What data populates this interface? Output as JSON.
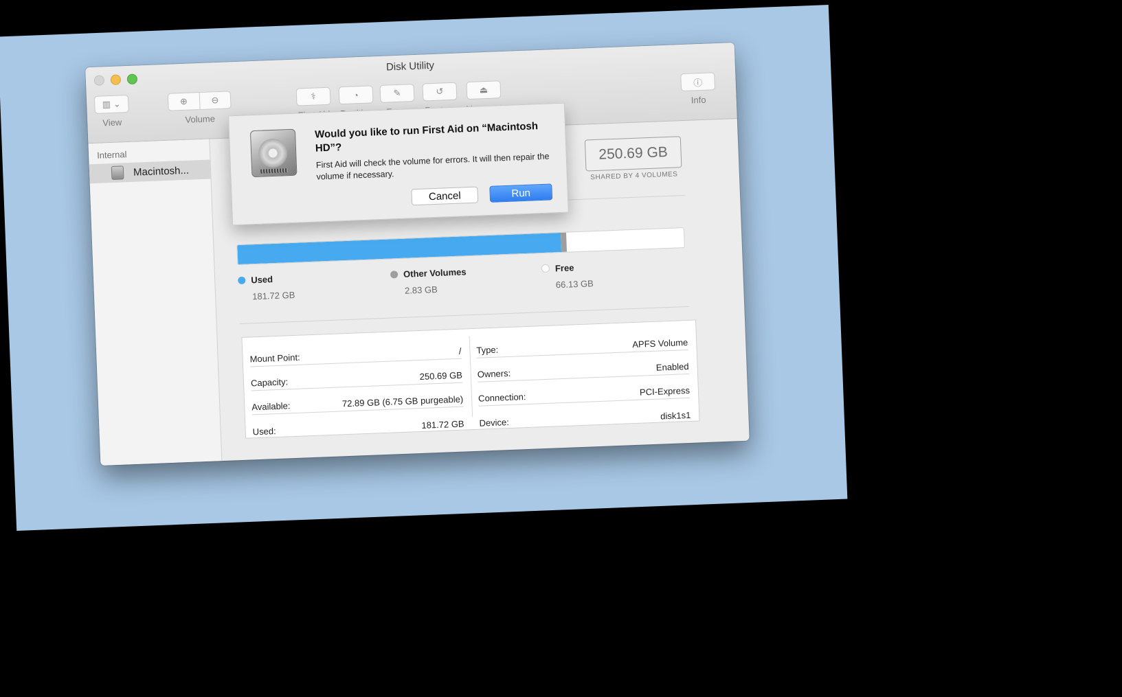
{
  "window": {
    "title": "Disk Utility"
  },
  "toolbar": {
    "view_label": "View",
    "volume_label": "Volume",
    "first_aid_label": "First Aid",
    "partition_label": "Partition",
    "erase_label": "Erase",
    "restore_label": "Restore",
    "unmount_label": "Unmount",
    "info_label": "Info"
  },
  "sidebar": {
    "section": "Internal",
    "items": [
      {
        "label": "Macintosh...",
        "icon": "disk-icon",
        "selected": true
      }
    ]
  },
  "volume": {
    "capacity": "250.69 GB",
    "shared_note": "SHARED BY 4 VOLUMES"
  },
  "usage": {
    "used_fraction": 0.7249,
    "other_fraction": 0.0113,
    "legend": [
      {
        "name": "Used",
        "value": "181.72 GB",
        "color": "#47aaf0"
      },
      {
        "name": "Other Volumes",
        "value": "2.83 GB",
        "color": "#9e9e9e"
      },
      {
        "name": "Free",
        "value": "66.13 GB",
        "color": "#ffffff"
      }
    ]
  },
  "info": {
    "left": [
      {
        "label": "Mount Point:",
        "value": "/"
      },
      {
        "label": "Capacity:",
        "value": "250.69 GB"
      },
      {
        "label": "Available:",
        "value": "72.89 GB (6.75 GB purgeable)"
      },
      {
        "label": "Used:",
        "value": "181.72 GB"
      }
    ],
    "right": [
      {
        "label": "Type:",
        "value": "APFS Volume"
      },
      {
        "label": "Owners:",
        "value": "Enabled"
      },
      {
        "label": "Connection:",
        "value": "PCI-Express"
      },
      {
        "label": "Device:",
        "value": "disk1s1"
      }
    ]
  },
  "dialog": {
    "title": "Would you like to run First Aid on “Macintosh HD”?",
    "message": "First Aid will check the volume for errors. It will then repair the volume if necessary.",
    "cancel_label": "Cancel",
    "run_label": "Run"
  }
}
